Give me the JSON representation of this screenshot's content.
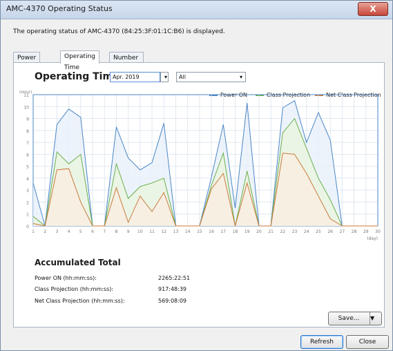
{
  "window": {
    "title": "AMC-4370 Operating Status",
    "close_glyph": "X"
  },
  "description": "The operating status of AMC-4370 (84:25:3F:01:1C:B6) is displayed.",
  "tabs": [
    {
      "label": "Power ON Time",
      "active": false
    },
    {
      "label": "Operating Time",
      "active": true
    },
    {
      "label": "Number of Wireless Clients",
      "active": false
    }
  ],
  "panel": {
    "heading": "Operating Time",
    "month_select": "Apr. 2019",
    "filter_select": "All"
  },
  "chart_data": {
    "type": "area",
    "ylabel": "(hour)",
    "xlabel": "(day)",
    "x": [
      1,
      2,
      3,
      4,
      5,
      6,
      7,
      8,
      9,
      10,
      11,
      12,
      13,
      14,
      15,
      16,
      17,
      18,
      19,
      20,
      21,
      22,
      23,
      24,
      25,
      26,
      27,
      28,
      29,
      30
    ],
    "x_ticks": [
      1,
      2,
      3,
      4,
      5,
      6,
      7,
      8,
      9,
      10,
      11,
      12,
      13,
      14,
      15,
      16,
      17,
      18,
      19,
      20,
      21,
      22,
      23,
      24,
      25,
      26,
      27,
      28,
      29,
      30
    ],
    "y_ticks": [
      0,
      1,
      2,
      3,
      4,
      5,
      6,
      7,
      8,
      9,
      10,
      11
    ],
    "ylim": [
      0,
      11
    ],
    "xlim": [
      1,
      30
    ],
    "grid": true,
    "legend_position": "top-right",
    "series": [
      {
        "name": "Power ON",
        "color": "#4a86c5",
        "fill": "#e8f0fa",
        "values": [
          3.6,
          0.0,
          8.5,
          9.8,
          9.1,
          0.0,
          0.0,
          8.3,
          5.7,
          4.7,
          5.3,
          8.6,
          0.0,
          0.0,
          0.0,
          4.1,
          8.5,
          1.5,
          10.3,
          0.0,
          0.0,
          9.9,
          10.5,
          7.0,
          9.5,
          7.2,
          0.0,
          0.0,
          0.0,
          0.0
        ]
      },
      {
        "name": "Class Projection",
        "color": "#6ab04c",
        "fill": "#eaf5e0",
        "values": [
          0.8,
          0.0,
          6.2,
          5.2,
          6.0,
          0.0,
          0.0,
          5.2,
          2.3,
          3.3,
          3.6,
          4.0,
          0.0,
          0.0,
          0.0,
          3.4,
          6.1,
          0.0,
          4.6,
          0.0,
          0.0,
          7.8,
          9.0,
          6.5,
          4.0,
          2.2,
          0.0,
          0.0,
          0.0,
          0.0
        ]
      },
      {
        "name": "Net Class Projection",
        "color": "#c97a3b",
        "fill": "#fbeee2",
        "values": [
          0.2,
          0.0,
          4.7,
          4.8,
          2.0,
          0.0,
          0.0,
          3.2,
          0.3,
          2.5,
          1.2,
          2.8,
          0.0,
          0.0,
          0.0,
          3.1,
          4.4,
          0.0,
          3.6,
          0.0,
          0.0,
          6.1,
          6.0,
          4.4,
          2.5,
          0.6,
          0.0,
          0.0,
          0.0,
          0.0
        ]
      }
    ]
  },
  "accumulated": {
    "title": "Accumulated Total",
    "rows": [
      {
        "label": "Power ON (hh:mm:ss):",
        "value": "2265:22:51"
      },
      {
        "label": "Class Projection (hh:mm:ss):",
        "value": "917:48:39"
      },
      {
        "label": "Net Class Projection (hh:mm:ss):",
        "value": "569:08:09"
      }
    ]
  },
  "buttons": {
    "save": "Save...",
    "save_menu_glyph": "▼",
    "refresh": "Refresh",
    "close": "Close"
  }
}
